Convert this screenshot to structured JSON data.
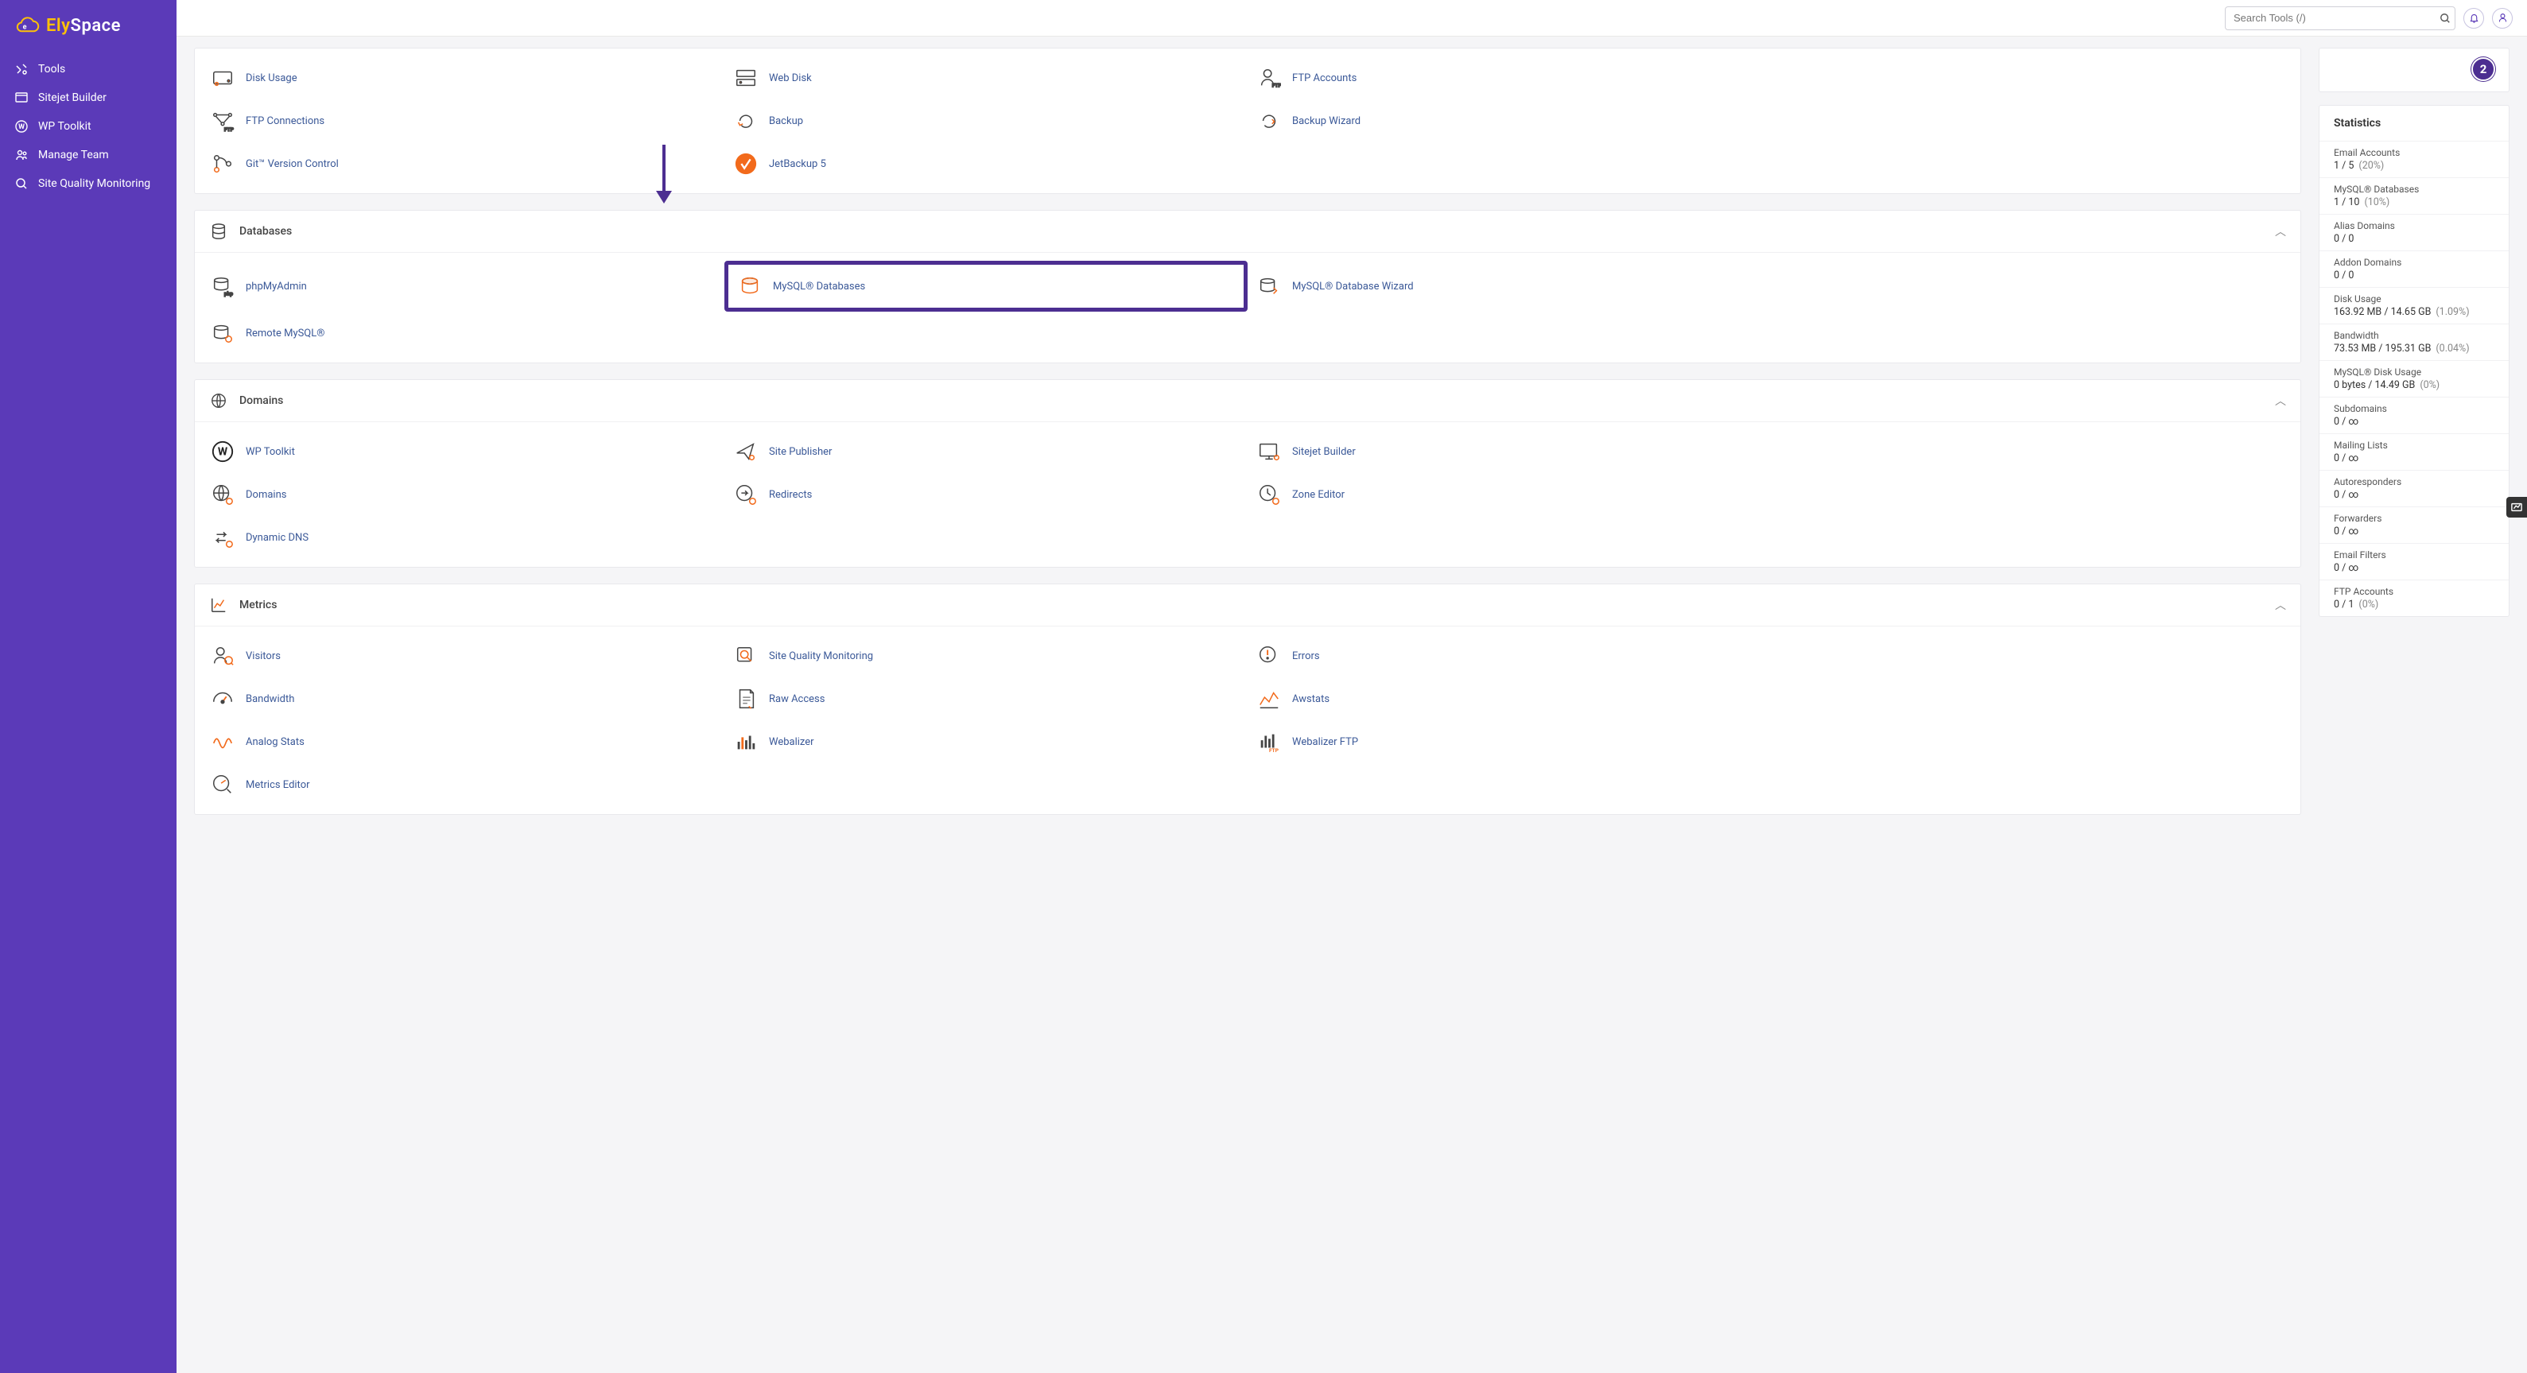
{
  "brand": {
    "name_part1": "Ely",
    "name_part2": "Space"
  },
  "search": {
    "placeholder": "Search Tools (/)"
  },
  "step_badge": "2",
  "sidebar": {
    "items": [
      {
        "label": "Tools",
        "icon": "tools-icon"
      },
      {
        "label": "Sitejet Builder",
        "icon": "sitejet-icon"
      },
      {
        "label": "WP Toolkit",
        "icon": "wordpress-icon"
      },
      {
        "label": "Manage Team",
        "icon": "team-icon"
      },
      {
        "label": "Site Quality Monitoring",
        "icon": "monitor-icon"
      }
    ]
  },
  "sections": {
    "files": {
      "tools": [
        {
          "label": "Disk Usage",
          "icon": "disk-icon"
        },
        {
          "label": "Web Disk",
          "icon": "webdisk-icon"
        },
        {
          "label": "FTP Accounts",
          "icon": "ftp-accounts-icon"
        },
        {
          "label": "FTP Connections",
          "icon": "ftp-conn-icon"
        },
        {
          "label": "Backup",
          "icon": "backup-icon"
        },
        {
          "label": "Backup Wizard",
          "icon": "backup-wizard-icon"
        },
        {
          "label": "Git™ Version Control",
          "icon": "git-icon"
        },
        {
          "label": "JetBackup 5",
          "icon": "jetbackup-icon"
        }
      ]
    },
    "databases": {
      "title": "Databases",
      "tools": [
        {
          "label": "phpMyAdmin",
          "icon": "phpmyadmin-icon"
        },
        {
          "label": "MySQL® Databases",
          "icon": "mysql-db-icon",
          "highlight": true
        },
        {
          "label": "MySQL® Database Wizard",
          "icon": "mysql-wizard-icon"
        },
        {
          "label": "Remote MySQL®",
          "icon": "remote-mysql-icon"
        }
      ]
    },
    "domains": {
      "title": "Domains",
      "tools": [
        {
          "label": "WP Toolkit",
          "icon": "wordpress-icon"
        },
        {
          "label": "Site Publisher",
          "icon": "publisher-icon"
        },
        {
          "label": "Sitejet Builder",
          "icon": "sitejet-tool-icon"
        },
        {
          "label": "Domains",
          "icon": "domains-icon"
        },
        {
          "label": "Redirects",
          "icon": "redirects-icon"
        },
        {
          "label": "Zone Editor",
          "icon": "zone-editor-icon"
        },
        {
          "label": "Dynamic DNS",
          "icon": "ddns-icon"
        }
      ]
    },
    "metrics": {
      "title": "Metrics",
      "tools": [
        {
          "label": "Visitors",
          "icon": "visitors-icon"
        },
        {
          "label": "Site Quality Monitoring",
          "icon": "sqm-icon"
        },
        {
          "label": "Errors",
          "icon": "errors-icon"
        },
        {
          "label": "Bandwidth",
          "icon": "bandwidth-icon"
        },
        {
          "label": "Raw Access",
          "icon": "raw-access-icon"
        },
        {
          "label": "Awstats",
          "icon": "awstats-icon"
        },
        {
          "label": "Analog Stats",
          "icon": "analog-icon"
        },
        {
          "label": "Webalizer",
          "icon": "webalizer-icon"
        },
        {
          "label": "Webalizer FTP",
          "icon": "webalizer-ftp-icon"
        },
        {
          "label": "Metrics Editor",
          "icon": "metrics-editor-icon"
        }
      ]
    }
  },
  "stats": {
    "title": "Statistics",
    "rows": [
      {
        "label": "Email Accounts",
        "value": "1 / 5",
        "pct": "(20%)"
      },
      {
        "label": "MySQL® Databases",
        "value": "1 / 10",
        "pct": "(10%)"
      },
      {
        "label": "Alias Domains",
        "value": "0 / 0",
        "pct": ""
      },
      {
        "label": "Addon Domains",
        "value": "0 / 0",
        "pct": ""
      },
      {
        "label": "Disk Usage",
        "value": "163.92 MB / 14.65 GB",
        "pct": "(1.09%)"
      },
      {
        "label": "Bandwidth",
        "value": "73.53 MB / 195.31 GB",
        "pct": "(0.04%)"
      },
      {
        "label": "MySQL® Disk Usage",
        "value": "0 bytes / 14.49 GB",
        "pct": "(0%)"
      },
      {
        "label": "Subdomains",
        "value": "0 / ∞",
        "pct": ""
      },
      {
        "label": "Mailing Lists",
        "value": "0 / ∞",
        "pct": ""
      },
      {
        "label": "Autoresponders",
        "value": "0 / ∞",
        "pct": ""
      },
      {
        "label": "Forwarders",
        "value": "0 / ∞",
        "pct": ""
      },
      {
        "label": "Email Filters",
        "value": "0 / ∞",
        "pct": ""
      },
      {
        "label": "FTP Accounts",
        "value": "0 / 1",
        "pct": "(0%)"
      }
    ]
  }
}
